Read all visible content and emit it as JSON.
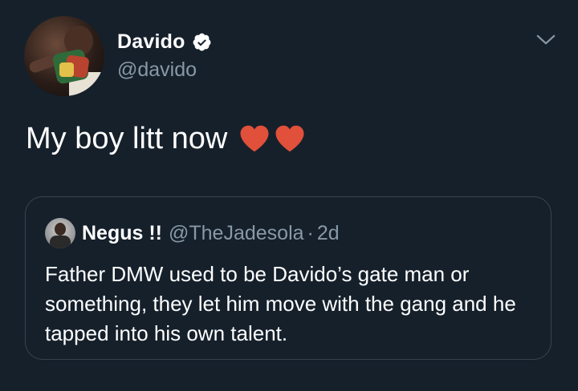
{
  "tweet": {
    "author": {
      "display_name": "Davido",
      "handle": "@davido",
      "verified": true,
      "avatar_icon": "profile-photo"
    },
    "text": "My boy litt now",
    "emojis": [
      "heart-icon",
      "heart-icon"
    ],
    "menu_icon": "chevron-down-icon"
  },
  "quote": {
    "author": {
      "display_name": "Negus !!",
      "handle": "@TheJadesola",
      "separator": "·",
      "time": "2d"
    },
    "text": "Father DMW used to be Davido’s gate man or something, they let him move with the gang and he tapped into his own talent."
  },
  "colors": {
    "background": "#15202b",
    "primary_text": "#ffffff",
    "secondary_text": "#8899a6",
    "border": "#38444d",
    "heart": "#e0503a"
  }
}
